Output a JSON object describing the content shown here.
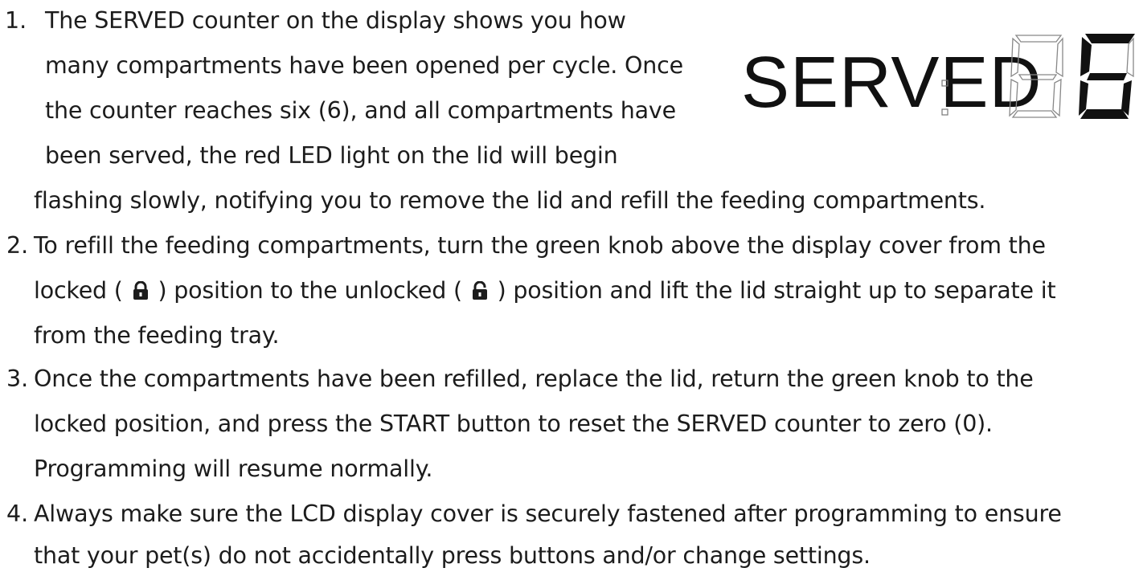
{
  "items": [
    {
      "number": "1.",
      "lines": [
        "The SERVED counter on the display shows you how",
        "many compartments have been opened per cycle. Once",
        "the counter reaches six (6), and all compartments have",
        "been served, the red LED light on the lid will begin",
        "flashing slowly, notifying you to remove the lid and refill the feeding compartments."
      ]
    },
    {
      "number": "2.",
      "line1": "To refill the feeding compartments, turn the green knob above the display cover from the",
      "line2_a": "locked (",
      "line2_b": ") position to the unlocked (",
      "line2_c": ") position and lift the lid straight up to separate it",
      "line3": "from the feeding tray."
    },
    {
      "number": "3.",
      "lines": [
        "Once the compartments have been refilled, replace the lid, return the green knob to the",
        "locked position, and press the START button to reset the SERVED counter to zero (0).",
        "Programming will resume normally."
      ]
    },
    {
      "number": "4.",
      "lines": [
        "Always make sure the LCD display cover is securely fastened after programming to ensure",
        "that your pet(s) do not accidentally press buttons and/or change settings."
      ]
    }
  ],
  "display": {
    "label": "SERVED",
    "value": "6"
  },
  "icons": [
    "locked-padlock-icon",
    "unlocked-padlock-icon"
  ]
}
